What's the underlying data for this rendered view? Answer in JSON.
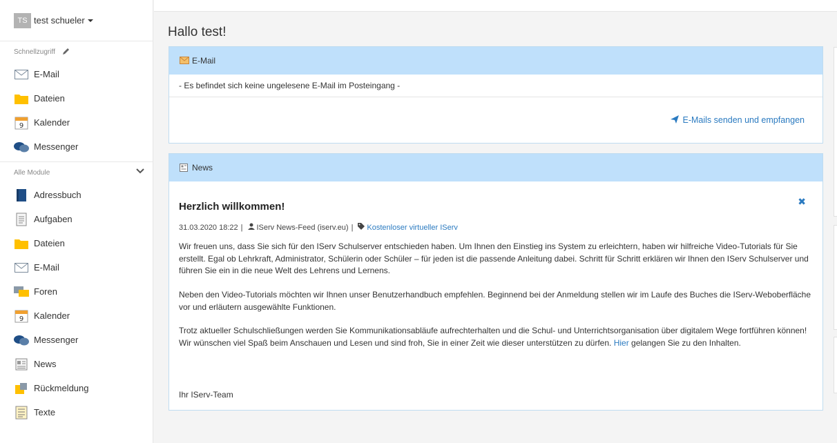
{
  "user": {
    "initials": "TS",
    "name": "test schueler"
  },
  "quick_access": {
    "label": "Schnellzugriff",
    "items": [
      {
        "label": "E-Mail",
        "icon": "envelope-icon"
      },
      {
        "label": "Dateien",
        "icon": "folder-icon"
      },
      {
        "label": "Kalender",
        "icon": "calendar-icon",
        "day": "9"
      },
      {
        "label": "Messenger",
        "icon": "chat-bubbles-icon"
      }
    ]
  },
  "all_modules": {
    "label": "Alle Module",
    "items": [
      {
        "label": "Adressbuch",
        "icon": "address-book-icon"
      },
      {
        "label": "Aufgaben",
        "icon": "clipboard-icon"
      },
      {
        "label": "Dateien",
        "icon": "folder-icon"
      },
      {
        "label": "E-Mail",
        "icon": "envelope-icon"
      },
      {
        "label": "Foren",
        "icon": "forum-icon"
      },
      {
        "label": "Kalender",
        "icon": "calendar-icon",
        "day": "9"
      },
      {
        "label": "Messenger",
        "icon": "chat-bubbles-icon"
      },
      {
        "label": "News",
        "icon": "newspaper-icon"
      },
      {
        "label": "Rückmeldung",
        "icon": "feedback-icon"
      },
      {
        "label": "Texte",
        "icon": "text-document-icon"
      }
    ]
  },
  "main": {
    "title": "Hallo test!"
  },
  "email_panel": {
    "title": "E-Mail",
    "message": "- Es befindet sich keine ungelesene E-Mail im Posteingang -",
    "link": "E-Mails senden und empfangen"
  },
  "news_panel": {
    "title": "News",
    "article": {
      "title": "Herzlich willkommen!",
      "date": "31.03.2020 18:22",
      "author": "IServ News-Feed (iserv.eu)",
      "tag": "Kostenloser virtueller IServ",
      "paragraph1": "Wir freuen uns, dass Sie sich für den IServ Schulserver entschieden haben. Um Ihnen den Einstieg ins System zu erleichtern, haben wir hilfreiche Video-Tutorials für Sie erstellt. Egal ob Lehrkraft, Administrator, Schülerin oder Schüler – für jeden ist die passende Anleitung dabei. Schritt für Schritt erklären wir Ihnen den IServ Schulserver und führen Sie ein in die neue Welt des Lehrens und Lernens.",
      "paragraph2": "Neben den Video-Tutorials möchten wir Ihnen unser Benutzerhandbuch empfehlen. Beginnend bei der Anmeldung stellen wir im Laufe des Buches die IServ-Weboberfläche vor und erläutern ausgewählte Funktionen.",
      "paragraph3_before": "Trotz aktueller Schulschließungen werden Sie Kommunikationsabläufe aufrechterhalten und die Schul- und Unterrichtsorganisation über digitalem Wege fortführen können! Wir wünschen viel Spaß beim Anschauen und Lesen und sind froh, Sie in einer Zeit wie dieser unterstützen zu dürfen. ",
      "paragraph3_link": "Hier",
      "paragraph3_after": " gelangen Sie zu den Inhalten.",
      "signature": "Ihr IServ-Team"
    }
  },
  "colors": {
    "accent": "#2a7ac0",
    "panel_header": "#bfe0fb",
    "folder": "#ffc000"
  }
}
